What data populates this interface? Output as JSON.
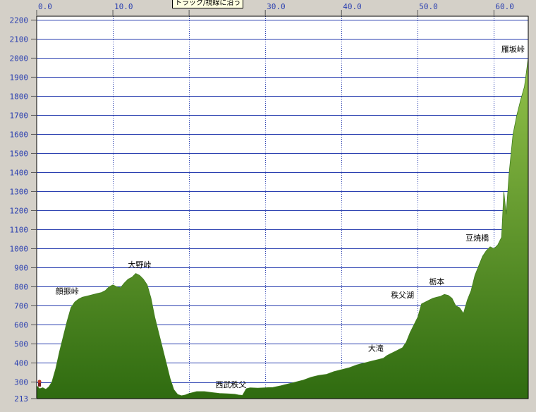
{
  "tooltip": "トラック/視線に沿う",
  "colors": {
    "background": "#d4d0c8",
    "plot_background": "#ffffff",
    "grid": "#2a3fb0",
    "fill_top": "#93c24a",
    "fill_bottom": "#2f6b10",
    "tick_text": "#2a3fb0"
  },
  "chart_data": {
    "type": "area",
    "title": "",
    "xlabel": "",
    "ylabel": "",
    "xlim": [
      0,
      64.5
    ],
    "ylim": [
      213,
      2220
    ],
    "grid": true,
    "x_ticks": [
      0,
      10,
      20,
      30,
      40,
      50,
      60
    ],
    "x_tick_labels": [
      "0.0",
      "10.0",
      "",
      "30.0",
      "40.0",
      "50.0",
      "60.0"
    ],
    "y_ticks": [
      2200,
      2100,
      2000,
      1900,
      1800,
      1700,
      1600,
      1500,
      1400,
      1300,
      1200,
      1100,
      1000,
      900,
      800,
      700,
      600,
      500,
      400,
      300,
      213
    ],
    "y_tick_labels": [
      "2200",
      "2100",
      "2000",
      "1900",
      "1800",
      "1700",
      "1600",
      "1500",
      "1400",
      "1300",
      "1200",
      "1100",
      "1000",
      "900",
      "800",
      "700",
      "600",
      "500",
      "400",
      "300",
      "213"
    ],
    "series": [
      {
        "x": [
          0,
          0.4,
          0.8,
          1.2,
          1.6,
          2.0,
          2.5,
          3.0,
          3.5,
          4.0,
          4.5,
          5.0,
          5.5,
          6.0,
          6.5,
          7.0,
          7.5,
          8.0,
          8.5,
          9.0,
          9.5,
          10.0,
          10.5,
          11.0,
          11.5,
          12.0,
          12.5,
          13.0,
          13.5,
          14.0,
          14.5,
          15.0,
          15.5,
          16.0,
          16.5,
          17.0,
          17.5,
          18.0,
          18.5,
          19.0,
          19.5,
          20.0,
          20.5,
          21.0,
          22.0,
          23.0,
          24.0,
          25.0,
          26.0,
          26.5,
          27.0,
          27.5,
          28.0,
          29.0,
          30.0,
          31.0,
          32.0,
          33.0,
          34.0,
          35.0,
          36.0,
          37.0,
          38.0,
          39.0,
          40.0,
          41.0,
          42.0,
          43.0,
          44.0,
          45.0,
          45.5,
          46.0,
          46.5,
          47.0,
          47.5,
          48.0,
          48.5,
          49.0,
          49.5,
          50.0,
          50.5,
          51.0,
          51.5,
          52.0,
          52.5,
          53.0,
          53.5,
          54.0,
          54.5,
          55.0,
          55.5,
          56.0,
          56.5,
          57.0,
          57.5,
          58.0,
          58.5,
          59.0,
          59.5,
          60.0,
          60.5,
          61.0,
          61.3,
          61.6,
          62.0,
          62.5,
          63.0,
          63.5,
          64.0,
          64.5
        ],
        "y": [
          280,
          265,
          270,
          262,
          275,
          300,
          370,
          460,
          540,
          620,
          690,
          720,
          735,
          745,
          750,
          755,
          760,
          765,
          770,
          780,
          800,
          810,
          800,
          795,
          820,
          840,
          850,
          870,
          860,
          840,
          810,
          740,
          640,
          560,
          480,
          400,
          320,
          260,
          235,
          228,
          232,
          240,
          245,
          250,
          250,
          245,
          240,
          238,
          236,
          232,
          230,
          265,
          270,
          268,
          270,
          272,
          280,
          290,
          300,
          310,
          325,
          335,
          340,
          355,
          365,
          375,
          390,
          400,
          410,
          420,
          425,
          440,
          450,
          460,
          470,
          480,
          510,
          560,
          600,
          640,
          710,
          720,
          730,
          740,
          745,
          750,
          760,
          755,
          740,
          700,
          690,
          660,
          730,
          780,
          860,
          910,
          960,
          990,
          1010,
          1000,
          1020,
          1060,
          1300,
          1180,
          1400,
          1600,
          1700,
          1780,
          1850,
          2000
        ],
        "fill": true
      }
    ],
    "annotations": [
      {
        "text": "顔振峠",
        "x": 4.0,
        "y": 740
      },
      {
        "text": "大野峠",
        "x": 13.5,
        "y": 880
      },
      {
        "text": "西武秩父",
        "x": 25.5,
        "y": 250
      },
      {
        "text": "大滝",
        "x": 44.5,
        "y": 440
      },
      {
        "text": "秩父湖",
        "x": 48.0,
        "y": 720
      },
      {
        "text": "栃本",
        "x": 52.5,
        "y": 790
      },
      {
        "text": "豆焼橋",
        "x": 57.8,
        "y": 1020
      },
      {
        "text": "雁坂峠",
        "x": 62.5,
        "y": 2010
      }
    ]
  }
}
